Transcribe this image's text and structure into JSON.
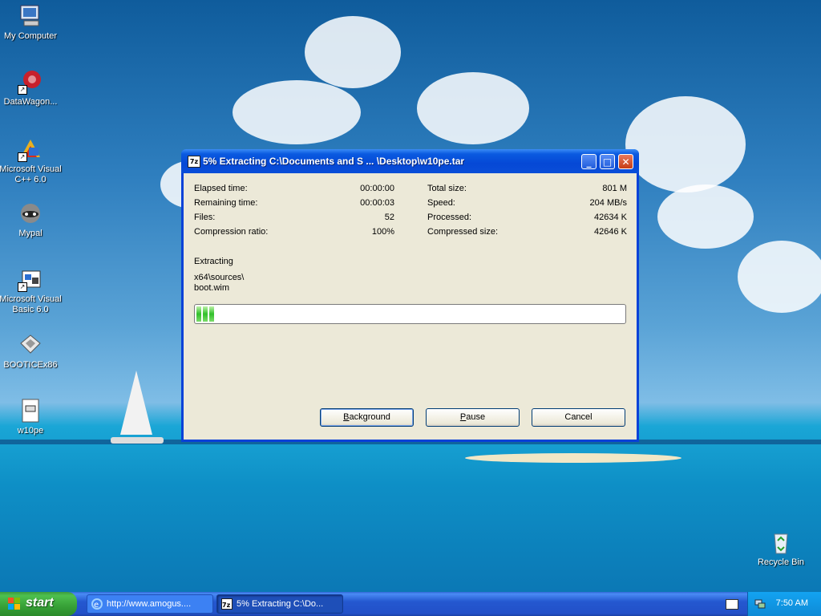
{
  "desktop": {
    "icons": [
      {
        "label": "My Computer"
      },
      {
        "label": "DataWagon..."
      },
      {
        "label": "Microsoft Visual C++ 6.0"
      },
      {
        "label": "Mypal"
      },
      {
        "label": "Microsoft Visual Basic 6.0"
      },
      {
        "label": "BOOTICEx86"
      },
      {
        "label": "w10pe"
      },
      {
        "label": "Recycle Bin"
      }
    ]
  },
  "window": {
    "app_icon": "7z",
    "title": "5% Extracting C:\\Documents and S ... \\Desktop\\w10pe.tar",
    "title_buttons": [
      "minimize-icon",
      "maximize-icon",
      "close-icon"
    ],
    "stats_left": [
      {
        "label": "Elapsed time:",
        "value": "00:00:00"
      },
      {
        "label": "Remaining time:",
        "value": "00:00:03"
      },
      {
        "label": "Files:",
        "value": "52"
      },
      {
        "label": "Compression ratio:",
        "value": "100%"
      }
    ],
    "stats_right": [
      {
        "label": "Total size:",
        "value": "801 M"
      },
      {
        "label": "Speed:",
        "value": "204 MB/s"
      },
      {
        "label": "Processed:",
        "value": "42634 K"
      },
      {
        "label": "Compressed size:",
        "value": "42646 K"
      }
    ],
    "status": "Extracting",
    "current_path": "x64\\sources\\",
    "current_file": "boot.wim",
    "progress_percent": 5,
    "buttons": {
      "background": {
        "prefix": "",
        "accel": "B",
        "rest": "ackground"
      },
      "pause": {
        "prefix": "",
        "accel": "P",
        "rest": "ause"
      },
      "cancel": "Cancel"
    }
  },
  "taskbar": {
    "start_label": "start",
    "tasks": [
      {
        "label": "http://www.amogus...."
      },
      {
        "label": "5% Extracting C:\\Do..."
      }
    ],
    "clock": "7:50 AM"
  },
  "colors": {
    "titlebar": "#0a4ed8",
    "progress_green": "#30c02a",
    "taskbar": "#2458d0",
    "start": "#37a137"
  }
}
